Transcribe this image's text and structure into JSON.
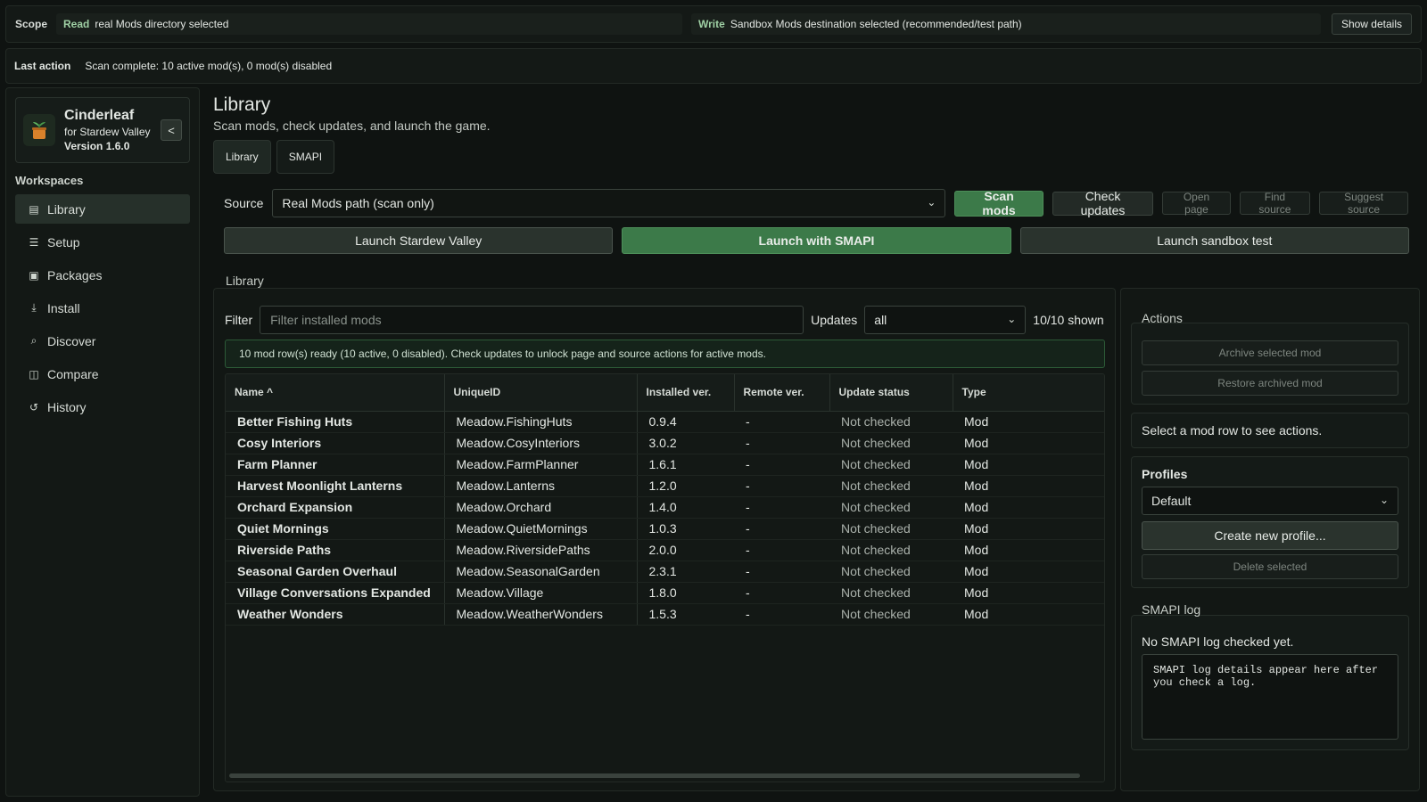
{
  "scope": {
    "label": "Scope",
    "read_key": "Read",
    "read_value": "real Mods directory selected",
    "write_key": "Write",
    "write_value": "Sandbox Mods destination selected (recommended/test path)",
    "show_details": "Show details"
  },
  "last_action": {
    "label": "Last action",
    "text": "Scan complete: 10 active mod(s), 0 mod(s) disabled"
  },
  "brand": {
    "title": "Cinderleaf",
    "subtitle": "for Stardew Valley",
    "version": "Version 1.6.0",
    "collapse": "<"
  },
  "sidebar": {
    "section_title": "Workspaces",
    "items": [
      {
        "label": "Library",
        "icon": "library-icon"
      },
      {
        "label": "Setup",
        "icon": "setup-icon"
      },
      {
        "label": "Packages",
        "icon": "packages-icon"
      },
      {
        "label": "Install",
        "icon": "install-icon"
      },
      {
        "label": "Discover",
        "icon": "discover-icon"
      },
      {
        "label": "Compare",
        "icon": "compare-icon"
      },
      {
        "label": "History",
        "icon": "history-icon"
      }
    ]
  },
  "main": {
    "title": "Library",
    "subtitle": "Scan mods, check updates, and launch the game.",
    "tabs": [
      "Library",
      "SMAPI"
    ]
  },
  "source": {
    "label": "Source",
    "selected": "Real Mods path (scan only)",
    "scan": "Scan mods",
    "check": "Check updates",
    "open_page": "Open page",
    "find_source": "Find source",
    "suggest_source": "Suggest source"
  },
  "launch": {
    "stardew": "Launch Stardew Valley",
    "smapi": "Launch with SMAPI",
    "sandbox": "Launch sandbox test"
  },
  "library": {
    "legend": "Library",
    "filter_label": "Filter",
    "filter_placeholder": "Filter installed mods",
    "updates_label": "Updates",
    "updates_value": "all",
    "shown": "10/10 shown",
    "status": "10 mod row(s) ready (10 active, 0 disabled). Check updates to unlock page and source actions for active mods.",
    "columns": [
      "Name ^",
      "UniqueID",
      "Installed ver.",
      "Remote ver.",
      "Update status",
      "Type"
    ],
    "rows": [
      {
        "name": "Better Fishing Huts",
        "uid": "Meadow.FishingHuts",
        "ver": "0.9.4",
        "remote": "-",
        "status": "Not checked",
        "type": "Mod"
      },
      {
        "name": "Cosy Interiors",
        "uid": "Meadow.CosyInteriors",
        "ver": "3.0.2",
        "remote": "-",
        "status": "Not checked",
        "type": "Mod"
      },
      {
        "name": "Farm Planner",
        "uid": "Meadow.FarmPlanner",
        "ver": "1.6.1",
        "remote": "-",
        "status": "Not checked",
        "type": "Mod"
      },
      {
        "name": "Harvest Moonlight Lanterns",
        "uid": "Meadow.Lanterns",
        "ver": "1.2.0",
        "remote": "-",
        "status": "Not checked",
        "type": "Mod"
      },
      {
        "name": "Orchard Expansion",
        "uid": "Meadow.Orchard",
        "ver": "1.4.0",
        "remote": "-",
        "status": "Not checked",
        "type": "Mod"
      },
      {
        "name": "Quiet Mornings",
        "uid": "Meadow.QuietMornings",
        "ver": "1.0.3",
        "remote": "-",
        "status": "Not checked",
        "type": "Mod"
      },
      {
        "name": "Riverside Paths",
        "uid": "Meadow.RiversidePaths",
        "ver": "2.0.0",
        "remote": "-",
        "status": "Not checked",
        "type": "Mod"
      },
      {
        "name": "Seasonal Garden Overhaul",
        "uid": "Meadow.SeasonalGarden",
        "ver": "2.3.1",
        "remote": "-",
        "status": "Not checked",
        "type": "Mod"
      },
      {
        "name": "Village Conversations Expanded",
        "uid": "Meadow.Village",
        "ver": "1.8.0",
        "remote": "-",
        "status": "Not checked",
        "type": "Mod"
      },
      {
        "name": "Weather Wonders",
        "uid": "Meadow.WeatherWonders",
        "ver": "1.5.3",
        "remote": "-",
        "status": "Not checked",
        "type": "Mod"
      }
    ]
  },
  "actions": {
    "legend": "Actions",
    "archive": "Archive selected mod",
    "restore": "Restore archived mod",
    "hint": "Select a mod row to see actions."
  },
  "profiles": {
    "title": "Profiles",
    "selected": "Default",
    "create": "Create new profile...",
    "delete": "Delete selected"
  },
  "smapi_log": {
    "legend": "SMAPI log",
    "status": "No SMAPI log checked yet.",
    "details": "SMAPI log details appear here after\nyou check a log."
  },
  "colors": {
    "accent": "#3c7a49",
    "background": "#0f1311"
  }
}
